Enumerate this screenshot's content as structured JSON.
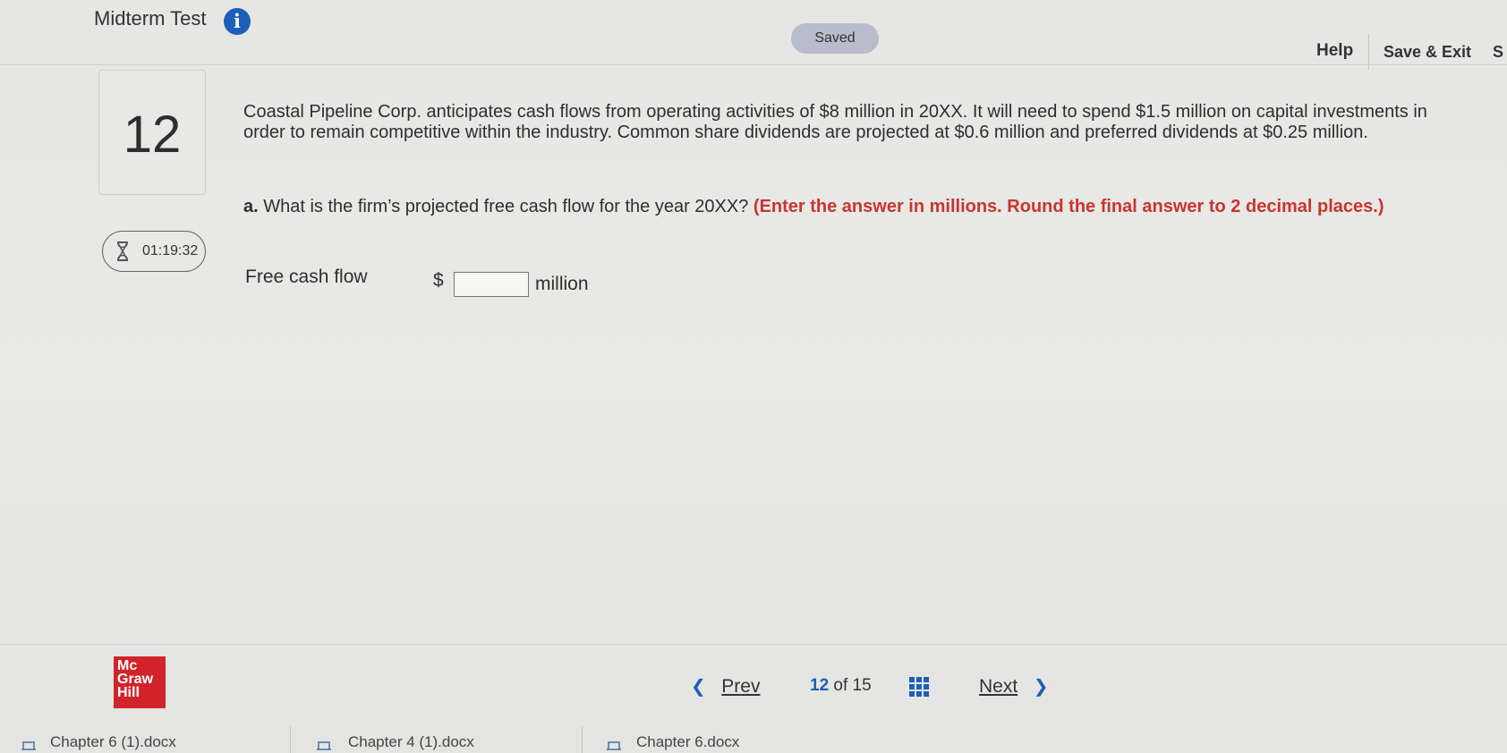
{
  "header": {
    "title": "Midterm Test",
    "info_icon": "i",
    "status": "Saved",
    "help": "Help",
    "save_exit": "Save & Exit",
    "edge_text": "S"
  },
  "question": {
    "number": "12",
    "timer": "01:19:32",
    "text": "Coastal Pipeline Corp. anticipates cash flows from operating activities of $8 million in 20XX. It will need to spend $1.5 million on capital investments in order to remain competitive within the industry. Common share dividends are projected at $0.6 million and preferred dividends at $0.25 million.",
    "part_label": "a.",
    "part_text": " What is the firm’s projected free cash flow for the year 20XX? ",
    "instruction": "(Enter the answer in millions. Round the final answer to 2 decimal places.)",
    "answer": {
      "label": "Free cash flow",
      "currency": "$",
      "value": "",
      "unit": "million"
    }
  },
  "footer": {
    "logo_lines": [
      "Mc",
      "Graw",
      "Hill"
    ],
    "prev": "Prev",
    "page_current": "12",
    "page_of": "of 15",
    "next": "Next"
  },
  "taskbar": {
    "items": [
      "Chapter 6 (1).docx",
      "Chapter 4 (1).docx",
      "Chapter 6.docx"
    ]
  },
  "colors": {
    "accent_blue": "#1c5fb8",
    "instruction_red": "#c8352f",
    "logo_red": "#d2232a",
    "saved_badge": "#b8bccb"
  },
  "icons": {
    "info": "info-icon",
    "timer": "hourglass-icon",
    "prev": "chevron-left-icon",
    "next": "chevron-right-icon",
    "grid": "grid-icon",
    "document": "document-icon"
  }
}
